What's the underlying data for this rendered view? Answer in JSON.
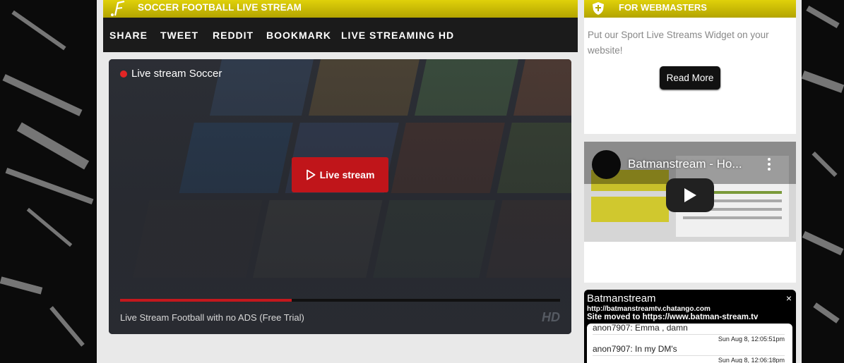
{
  "header": {
    "title": "SOCCER FOOTBALL LIVE STREAM"
  },
  "share_bar": {
    "items": [
      "SHARE",
      "TWEET",
      "REDDIT",
      "BOOKMARK",
      "LIVE STREAMING HD"
    ]
  },
  "player": {
    "live_label": "Live stream Soccer",
    "play_button_label": "Live stream",
    "progress_percent": 39,
    "caption": "Live Stream Football with no ADS (Free Trial)",
    "hd_badge": "HD"
  },
  "webmasters": {
    "title": "FOR WEBMASTERS",
    "text": "Put our Sport Live Streams Widget on your website!",
    "button_label": "Read More"
  },
  "youtube": {
    "video_title": "Batmanstream - Ho..."
  },
  "chat": {
    "name": "Batmanstream",
    "close_glyph": "×",
    "url": "http://batmanstreamtv.chatango.com",
    "notice": "Site moved to https://www.batman-stream.tv",
    "messages": [
      {
        "time": "",
        "text": "anon7907: Emma , damn"
      },
      {
        "time": "Sun Aug 8, 12:05:51pm",
        "text": "anon7907: In my DM's"
      },
      {
        "time": "Sun Aug 8, 12:06:18pm",
        "text": ""
      }
    ]
  },
  "colors": {
    "accent_yellow": "#c9ba05",
    "live_red": "#c0151a",
    "dark_bar": "#1b1b1b"
  }
}
